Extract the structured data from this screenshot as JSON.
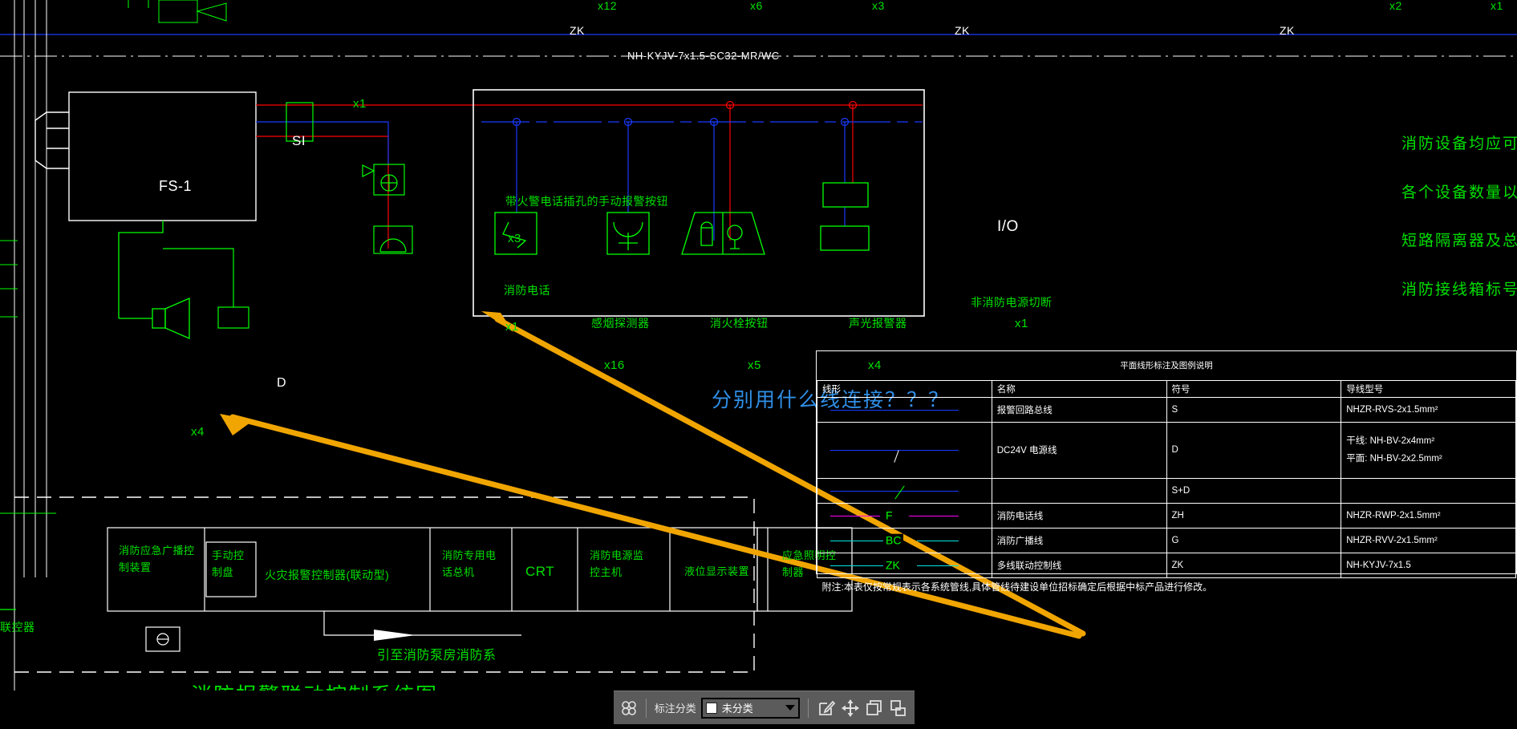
{
  "drawing": {
    "title_bottom": "消防报警联动控制系统图",
    "question_annotation": "分别用什么线连接？？？",
    "top_cable_label": "NH-KYJV-7x1.5-SC32-MR/WC",
    "zk_labels": [
      "ZK",
      "ZK",
      "ZK"
    ],
    "top_counts": [
      "x12",
      "x6",
      "x3",
      "x2",
      "x1"
    ],
    "fs1_label": "FS-1",
    "si_label": "SI",
    "io_label": "I/O",
    "d_label": "D",
    "crt_label": "CRT",
    "x1_near_si": "x1",
    "x3_label": "x3",
    "x1_phone": "x1",
    "x4_speaker": "x4",
    "manual_call_point_note": "带火警电话插孔的手动报警按钮",
    "fire_phone_note": "消防电话",
    "pump_note": "引至消防泵房消防系"
  },
  "devices": [
    {
      "name": "感烟探测器",
      "count": "x16",
      "symbol": "smoke-detector"
    },
    {
      "name": "消火栓按钮",
      "count": "x5",
      "symbol": "hydrant-button"
    },
    {
      "name": "声光报警器",
      "count": "x4",
      "symbol": "sound-light-alarm"
    },
    {
      "name": "非消防电源切断",
      "count": "x1",
      "symbol": "power-cutoff"
    }
  ],
  "control_panel_cells": [
    "消防应急广播控制装置",
    "手动控制盘",
    "火灾报警控制器(联动型)",
    "消防专用电话总机",
    "CRT",
    "消防电源监控主机",
    "液位显示装置",
    "应急照明控制器"
  ],
  "right_notes": [
    "消防设备均应可靠",
    "各个设备数量以平",
    "短路隔离器及总线",
    "消防接线箱标号"
  ],
  "legend": {
    "title": "平面线形标注及图例说明",
    "headers": [
      "线形",
      "名称",
      "符号",
      "导线型号"
    ],
    "rows": [
      {
        "line_style": "solid-blue",
        "name": "报警回路总线",
        "symbol": "S",
        "wire_type": "NHZR-RVS-2x1.5mm²"
      },
      {
        "line_style": "blue-tick",
        "name": "DC24V  电源线",
        "symbol": "D",
        "wire_type_1": "干线:  NH-BV-2x4mm²",
        "wire_type_2": "平面:  NH-BV-2x2.5mm²"
      },
      {
        "line_style": "blue-slash",
        "name": "",
        "symbol": "S+D",
        "wire_type": ""
      },
      {
        "line_style": "magenta-F",
        "name": "消防电话线",
        "symbol": "ZH",
        "wire_type": "NHZR-RWP-2x1.5mm²"
      },
      {
        "line_style": "cyan-BC",
        "name": "消防广播线",
        "symbol": "G",
        "wire_type": "NHZR-RVV-2x1.5mm²"
      },
      {
        "line_style": "cyan-ZK",
        "name": "多线联动控制线",
        "symbol": "ZK",
        "wire_type": "NH-KYJV-7x1.5"
      }
    ],
    "note": "附注:本表仅按常规表示各系统管线,具体管线待建设单位招标确定后根据中标产品进行修改。"
  },
  "toolbar": {
    "category_label": "标注分类",
    "category_value": "未分类",
    "swatch_color": "#ffffff",
    "icons": [
      "grid-icon",
      "edit-annotation-icon",
      "move-icon",
      "copy-icon",
      "paste-icon"
    ]
  },
  "colors": {
    "background": "#000000",
    "device_green": "#00ff00",
    "alarm_bus_blue": "#1a3aff",
    "power_red": "#ff0000",
    "phone_magenta": "#ff00ff",
    "broadcast_cyan": "#00e5e5",
    "annotation_blue": "#2f8fe8",
    "arrow_orange": "#f0a500",
    "frame_white": "#ffffff"
  }
}
